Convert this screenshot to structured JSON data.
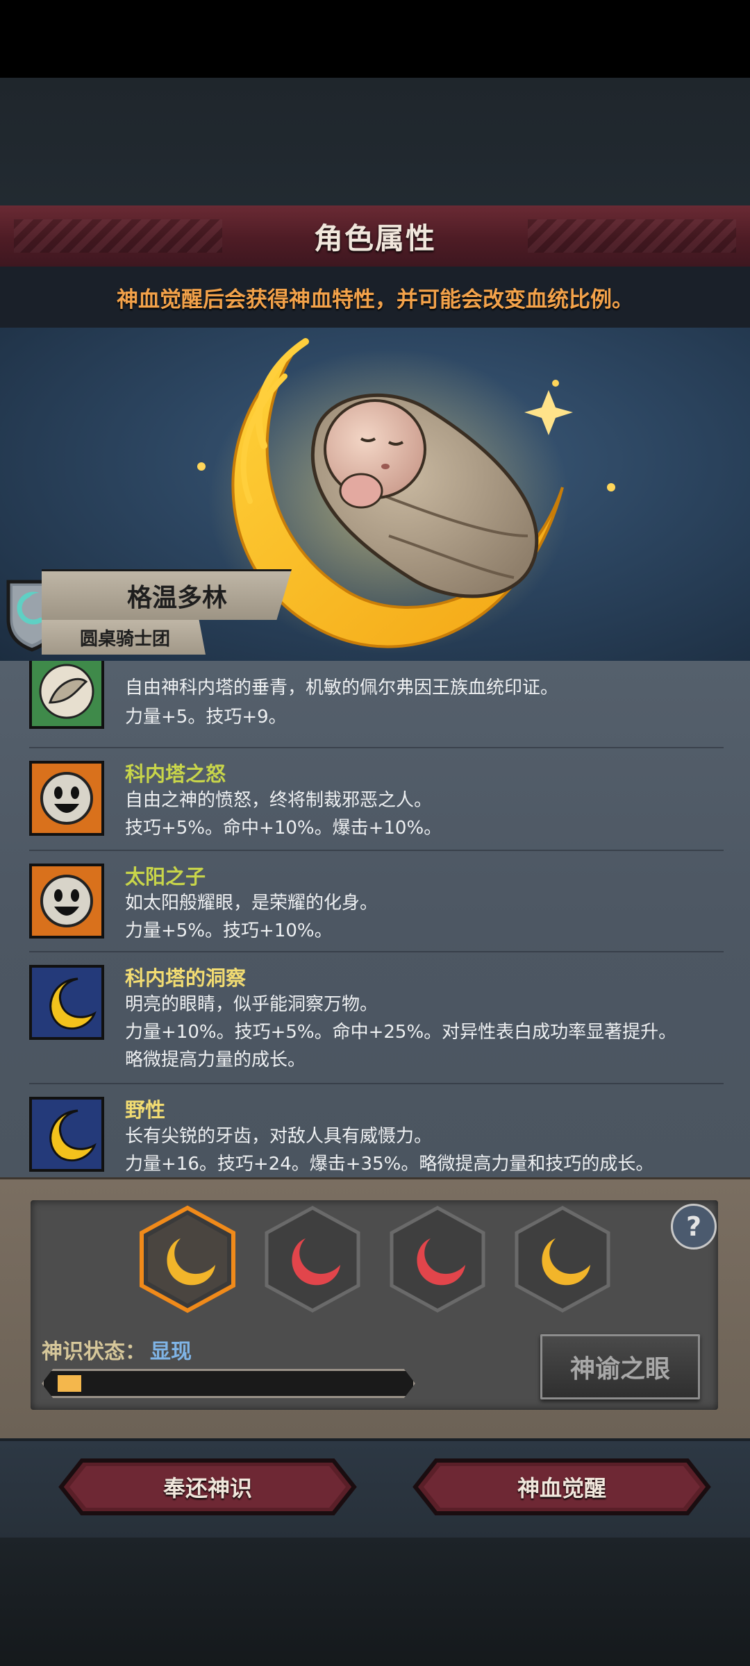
{
  "header": {
    "title": "角色属性",
    "subtitle": "神血觉醒后会获得神血特性，并可能会改变血统比例。"
  },
  "character": {
    "name": "格温多林",
    "guild": "圆桌骑士团"
  },
  "traits": [
    {
      "name": "",
      "icon": "feather-icon",
      "description": "自由神科内塔的垂青，机敏的佩尔弗因王族血统印证。",
      "effect": "力量+5。技巧+9。",
      "extra": ""
    },
    {
      "name": "科内塔之怒",
      "icon": "smiley-face-icon",
      "description": "自由之神的愤怒，终将制裁邪恶之人。",
      "effect": "技巧+5%。命中+10%。爆击+10%。",
      "extra": ""
    },
    {
      "name": "太阳之子",
      "icon": "smiley-face-icon",
      "description": "如太阳般耀眼，是荣耀的化身。",
      "effect": "力量+5%。技巧+10%。",
      "extra": ""
    },
    {
      "name": "科内塔的洞察",
      "icon": "crescent-moon-icon",
      "description": "明亮的眼睛，似乎能洞察万物。",
      "effect": "力量+10%。技巧+5%。命中+25%。对异性表白成功率显著提升。",
      "extra": "略微提高力量的成长。"
    },
    {
      "name": "野性",
      "icon": "crescent-moon-icon",
      "description": "长有尖锐的牙齿，对敌人具有威慑力。",
      "effect": "力量+16。技巧+24。爆击+35%。略微提高力量和技巧的成长。",
      "extra": ""
    }
  ],
  "divine": {
    "status_label": "神识状态：",
    "status_value": "显现",
    "progress": 0.07,
    "slots": [
      {
        "icon": "golden-moon-slot-icon",
        "selected": true,
        "color": "#f2b52a"
      },
      {
        "icon": "red-moon-slot-icon",
        "selected": false,
        "color": "#e2454b"
      },
      {
        "icon": "red-moon-slot-icon",
        "selected": false,
        "color": "#e2454b"
      },
      {
        "icon": "golden-moon-slot-icon",
        "selected": false,
        "color": "#f2b52a"
      }
    ],
    "oracle_button": "神谕之眼",
    "help_symbol": "?"
  },
  "actions": {
    "return_label": "奉还神识",
    "awaken_label": "神血觉醒"
  },
  "colors": {
    "accent_orange": "#f3a24a",
    "banner_red": "#5b2230",
    "trait_green": "#c8d54a",
    "trait_yellow": "#f2dc72",
    "status_blue": "#7fb4e6"
  }
}
